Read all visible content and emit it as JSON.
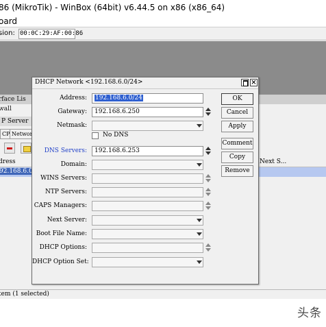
{
  "window": {
    "title": "86 (MikroTik) - WinBox (64bit) v6.44.5 on x86 (x86_64)",
    "menu_item": "oard",
    "session_label": "sion:",
    "session_value": "00:0C:29:AF:00:86"
  },
  "background": {
    "menu_interface_list": "rface Lis",
    "menu_firewall": "wall",
    "dhcp_server_title": "P Server",
    "tabs": [
      "CP",
      "Networ"
    ],
    "columns": {
      "address": "dress",
      "next_server": "Next S..."
    },
    "selected_address": "92.168.6.0/",
    "status_text": "tem (1 selected)",
    "watermark": "头条"
  },
  "dialog": {
    "title": "DHCP Network <192.168.6.0/24>",
    "fields": {
      "address": {
        "label": "Address:",
        "value": "192.168.6.0/24"
      },
      "gateway": {
        "label": "Gateway:",
        "value": "192.168.6.250"
      },
      "netmask": {
        "label": "Netmask:",
        "value": ""
      },
      "no_dns": {
        "label": "No DNS",
        "checked": false
      },
      "dns_servers": {
        "label": "DNS Servers:",
        "value": "192.168.6.253"
      },
      "domain": {
        "label": "Domain:",
        "value": ""
      },
      "wins_servers": {
        "label": "WINS Servers:",
        "value": ""
      },
      "ntp_servers": {
        "label": "NTP Servers:",
        "value": ""
      },
      "caps_managers": {
        "label": "CAPS Managers:",
        "value": ""
      },
      "next_server": {
        "label": "Next Server:",
        "value": ""
      },
      "boot_file_name": {
        "label": "Boot File Name:",
        "value": ""
      },
      "dhcp_options": {
        "label": "DHCP Options:",
        "value": ""
      },
      "dhcp_option_set": {
        "label": "DHCP Option Set:",
        "value": ""
      }
    },
    "buttons": {
      "ok": "OK",
      "cancel": "Cancel",
      "apply": "Apply",
      "comment": "Comment",
      "copy": "Copy",
      "remove": "Remove"
    }
  }
}
